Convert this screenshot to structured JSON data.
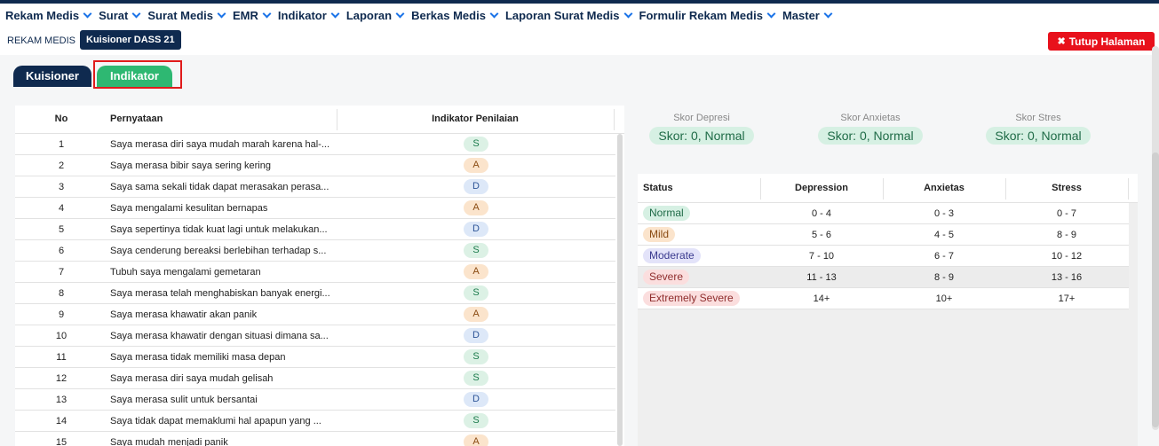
{
  "menu": [
    {
      "label": "Rekam Medis"
    },
    {
      "label": "Surat"
    },
    {
      "label": "Surat Medis"
    },
    {
      "label": "EMR"
    },
    {
      "label": "Indikator"
    },
    {
      "label": "Laporan"
    },
    {
      "label": "Berkas Medis"
    },
    {
      "label": "Laporan Surat Medis"
    },
    {
      "label": "Formulir Rekam Medis"
    },
    {
      "label": "Master"
    }
  ],
  "breadcrumb": {
    "root": "REKAM MEDIS",
    "active_tab": "Kuisioner DASS 21"
  },
  "close_button": {
    "label": "Tutup Halaman",
    "icon": "close-icon"
  },
  "tabs": {
    "kuisioner": "Kuisioner",
    "indikator": "Indikator"
  },
  "left_table": {
    "headers": {
      "no": "No",
      "statement": "Pernyataan",
      "indicator": "Indikator Penilaian"
    },
    "rows": [
      {
        "no": "1",
        "statement": "Saya merasa diri saya mudah marah karena hal-...",
        "indicator": "S"
      },
      {
        "no": "2",
        "statement": "Saya merasa bibir saya sering kering",
        "indicator": "A"
      },
      {
        "no": "3",
        "statement": "Saya sama sekali tidak dapat merasakan perasa...",
        "indicator": "D"
      },
      {
        "no": "4",
        "statement": "Saya mengalami kesulitan bernapas",
        "indicator": "A"
      },
      {
        "no": "5",
        "statement": "Saya sepertinya tidak kuat lagi untuk melakukan...",
        "indicator": "D"
      },
      {
        "no": "6",
        "statement": "Saya cenderung bereaksi berlebihan terhadap s...",
        "indicator": "S"
      },
      {
        "no": "7",
        "statement": "Tubuh saya mengalami gemetaran",
        "indicator": "A"
      },
      {
        "no": "8",
        "statement": "Saya merasa telah menghabiskan banyak energi...",
        "indicator": "S"
      },
      {
        "no": "9",
        "statement": "Saya merasa khawatir akan panik",
        "indicator": "A"
      },
      {
        "no": "10",
        "statement": "Saya merasa khawatir dengan situasi dimana sa...",
        "indicator": "D"
      },
      {
        "no": "11",
        "statement": "Saya merasa tidak memiliki masa depan",
        "indicator": "S"
      },
      {
        "no": "12",
        "statement": "Saya merasa diri saya mudah gelisah",
        "indicator": "S"
      },
      {
        "no": "13",
        "statement": "Saya merasa sulit untuk bersantai",
        "indicator": "D"
      },
      {
        "no": "14",
        "statement": "Saya tidak dapat memaklumi hal apapun yang ...",
        "indicator": "S"
      },
      {
        "no": "15",
        "statement": "Saya mudah menjadi panik",
        "indicator": "A"
      }
    ]
  },
  "scores": {
    "depresi": {
      "label": "Skor Depresi",
      "value": "Skor: 0, Normal"
    },
    "anxietas": {
      "label": "Skor Anxietas",
      "value": "Skor: 0, Normal"
    },
    "stres": {
      "label": "Skor Stres",
      "value": "Skor: 0, Normal"
    }
  },
  "right_table": {
    "headers": {
      "status": "Status",
      "depression": "Depression",
      "anxietas": "Anxietas",
      "stress": "Stress"
    },
    "rows": [
      {
        "status": "Normal",
        "depression": "0 - 4",
        "anxietas": "0 - 3",
        "stress": "0 - 7",
        "color": "#d6f0e3",
        "text_color": "#1f6b47"
      },
      {
        "status": "Mild",
        "depression": "5 - 6",
        "anxietas": "4 - 5",
        "stress": "8 - 9",
        "color": "#fbe4cc",
        "text_color": "#8a4b12"
      },
      {
        "status": "Moderate",
        "depression": "7 - 10",
        "anxietas": "6 - 7",
        "stress": "10 - 12",
        "color": "#e3e3f9",
        "text_color": "#3b3b8f"
      },
      {
        "status": "Severe",
        "depression": "11 - 13",
        "anxietas": "8 - 9",
        "stress": "13 - 16",
        "color": "#fbdede",
        "text_color": "#8f2d2d"
      },
      {
        "status": "Extremely Severe",
        "depression": "14+",
        "anxietas": "10+",
        "stress": "17+",
        "color": "#fbdede",
        "text_color": "#8f2d2d"
      }
    ]
  },
  "colors": {
    "navy": "#0f2a4f",
    "green": "#2eb872",
    "red": "#e8111c",
    "accent_blue": "#1a73e8"
  }
}
